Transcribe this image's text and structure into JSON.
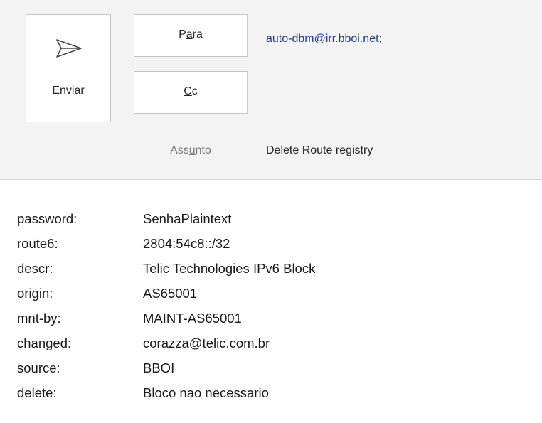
{
  "send": {
    "label_accel": "E",
    "label_rest": "nviar",
    "icon": "send-arrow-icon"
  },
  "fields": {
    "to": {
      "label_pre": "P",
      "label_accel": "a",
      "label_post": "ra",
      "value": "auto-dbm@irr.bboi.net",
      "separator": ";"
    },
    "cc": {
      "label_accel": "C",
      "label_rest": "c",
      "value": ""
    },
    "subject": {
      "label_pre": "Ass",
      "label_accel": "u",
      "label_post": "nto",
      "value": "Delete Route registry"
    }
  },
  "body": {
    "rows": [
      {
        "key": "password:",
        "value": "SenhaPlaintext"
      },
      {
        "key": "route6:",
        "value": "2804:54c8::/32"
      },
      {
        "key": "descr:",
        "value": "Telic Technologies IPv6 Block"
      },
      {
        "key": "origin:",
        "value": "AS65001"
      },
      {
        "key": "mnt-by:",
        "value": "MAINT-AS65001"
      },
      {
        "key": "changed:",
        "value": "corazza@telic.com.br"
      },
      {
        "key": "source:",
        "value": "BBOI"
      },
      {
        "key": "delete:",
        "value": "Bloco nao necessario"
      }
    ]
  },
  "colors": {
    "header_bg": "#f3f3f3",
    "link": "#1f3b8a",
    "border": "#c6c6c6"
  }
}
